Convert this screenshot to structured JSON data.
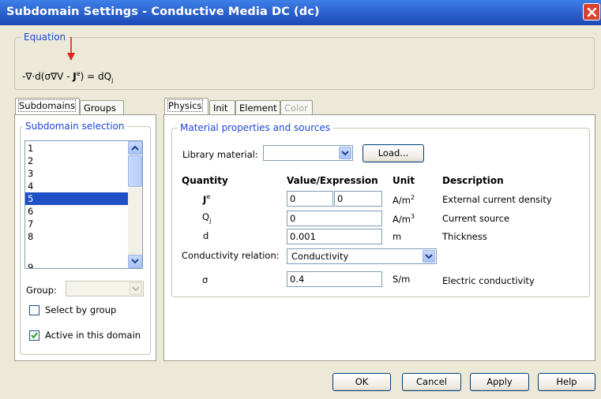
{
  "window": {
    "title": "Subdomain Settings - Conductive Media DC (dc)"
  },
  "equation": {
    "legend": "Equation",
    "formula_main": "-∇·d(σ∇V - ",
    "formula_bold_J": "J",
    "formula_sup_e": "e",
    "formula_tail": ") = dQ",
    "formula_sub_j": "j"
  },
  "left_tabs": {
    "subdomains": "Subdomains",
    "groups": "Groups"
  },
  "subdomain_selection": {
    "legend": "Subdomain selection",
    "items": [
      "1",
      "2",
      "3",
      "4",
      "5",
      "6",
      "7",
      "8",
      "9"
    ],
    "selected": "5",
    "group_label": "Group:",
    "group_value": "",
    "select_by_group": "Select by group",
    "select_by_group_checked": false,
    "active_in_domain": "Active in this domain",
    "active_in_domain_checked": true
  },
  "right_tabs": {
    "physics": "Physics",
    "init": "Init",
    "element": "Element",
    "color": "Color"
  },
  "material": {
    "legend": "Material properties and sources",
    "library_label": "Library material:",
    "library_value": "",
    "load_button": "Load..."
  },
  "table": {
    "headers": {
      "quantity": "Quantity",
      "value": "Value/Expression",
      "unit": "Unit",
      "description": "Description"
    },
    "je": {
      "q_main": "J",
      "q_sup": "e",
      "value1": "0",
      "value2": "0",
      "unit_main": "A/m",
      "unit_sup": "2",
      "description": "External current density"
    },
    "qj": {
      "q_main": "Q",
      "q_sub": "j",
      "value": "0",
      "unit_main": "A/m",
      "unit_sup": "3",
      "description": "Current source"
    },
    "d": {
      "q": "d",
      "value": "0.001",
      "unit": "m",
      "description": "Thickness"
    },
    "conductivity_relation": {
      "label": "Conductivity relation:",
      "value": "Conductivity"
    },
    "sigma": {
      "q": "σ",
      "value": "0.4",
      "unit": "S/m",
      "description": "Electric conductivity"
    }
  },
  "buttons": {
    "ok": "OK",
    "cancel": "Cancel",
    "apply": "Apply",
    "help": "Help"
  }
}
